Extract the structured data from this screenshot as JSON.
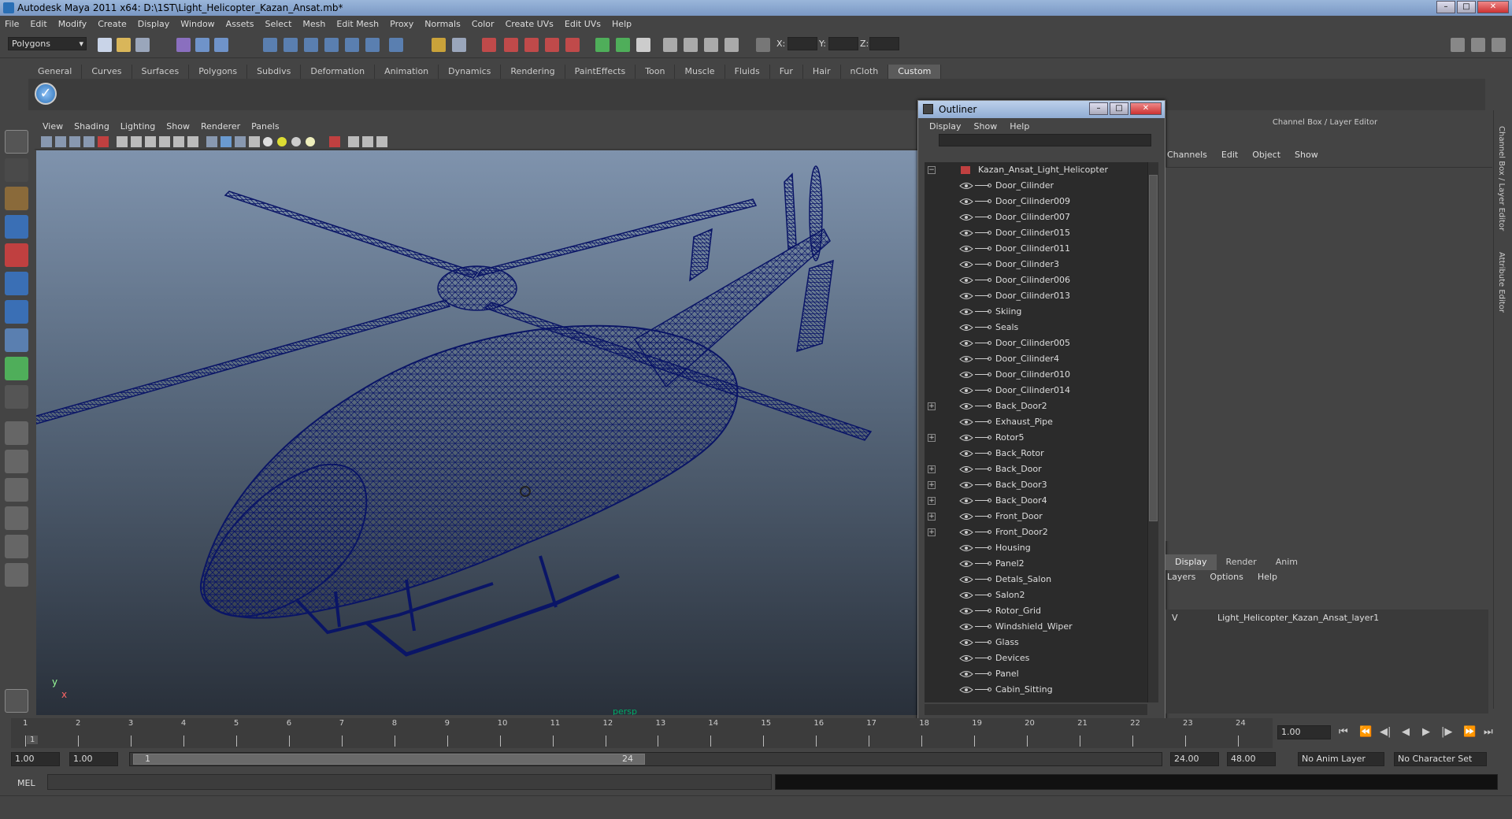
{
  "window": {
    "title": "Autodesk Maya 2011 x64: D:\\1ST\\Light_Helicopter_Kazan_Ansat.mb*",
    "buttons": [
      "–",
      "□",
      "✕"
    ]
  },
  "menubar": [
    "File",
    "Edit",
    "Modify",
    "Create",
    "Display",
    "Window",
    "Assets",
    "Select",
    "Mesh",
    "Edit Mesh",
    "Proxy",
    "Normals",
    "Color",
    "Create UVs",
    "Edit UVs",
    "Help"
  ],
  "toolbar": {
    "mode": "Polygons",
    "coords": {
      "x_label": "X:",
      "y_label": "Y:",
      "z_label": "Z:"
    }
  },
  "shelf": {
    "tabs": [
      "General",
      "Curves",
      "Surfaces",
      "Polygons",
      "Subdivs",
      "Deformation",
      "Animation",
      "Dynamics",
      "Rendering",
      "PaintEffects",
      "Toon",
      "Muscle",
      "Fluids",
      "Fur",
      "Hair",
      "nCloth",
      "Custom"
    ],
    "active": "Custom"
  },
  "viewport": {
    "menu": [
      "View",
      "Shading",
      "Lighting",
      "Show",
      "Renderer",
      "Panels"
    ],
    "camera_label": "persp",
    "axis_y": "y",
    "axis_x": "x",
    "wire_color": "#0a1566"
  },
  "outliner": {
    "title": "Outliner",
    "menu": [
      "Display",
      "Show",
      "Help"
    ],
    "root": "Kazan_Ansat_Light_Helicopter",
    "items": [
      {
        "label": "Door_Cilinder",
        "expandable": false
      },
      {
        "label": "Door_Cilinder009",
        "expandable": false
      },
      {
        "label": "Door_Cilinder007",
        "expandable": false
      },
      {
        "label": "Door_Cilinder015",
        "expandable": false
      },
      {
        "label": "Door_Cilinder011",
        "expandable": false
      },
      {
        "label": "Door_Cilinder3",
        "expandable": false
      },
      {
        "label": "Door_Cilinder006",
        "expandable": false
      },
      {
        "label": "Door_Cilinder013",
        "expandable": false
      },
      {
        "label": "Skiing",
        "expandable": false
      },
      {
        "label": "Seals",
        "expandable": false
      },
      {
        "label": "Door_Cilinder005",
        "expandable": false
      },
      {
        "label": "Door_Cilinder4",
        "expandable": false
      },
      {
        "label": "Door_Cilinder010",
        "expandable": false
      },
      {
        "label": "Door_Cilinder014",
        "expandable": false
      },
      {
        "label": "Back_Door2",
        "expandable": true
      },
      {
        "label": "Exhaust_Pipe",
        "expandable": false
      },
      {
        "label": "Rotor5",
        "expandable": true
      },
      {
        "label": "Back_Rotor",
        "expandable": false
      },
      {
        "label": "Back_Door",
        "expandable": true
      },
      {
        "label": "Back_Door3",
        "expandable": true
      },
      {
        "label": "Back_Door4",
        "expandable": true
      },
      {
        "label": "Front_Door",
        "expandable": true
      },
      {
        "label": "Front_Door2",
        "expandable": true
      },
      {
        "label": "Housing",
        "expandable": false
      },
      {
        "label": "Panel2",
        "expandable": false
      },
      {
        "label": "Detals_Salon",
        "expandable": false
      },
      {
        "label": "Salon2",
        "expandable": false
      },
      {
        "label": "Rotor_Grid",
        "expandable": false
      },
      {
        "label": "Windshield_Wiper",
        "expandable": false
      },
      {
        "label": "Glass",
        "expandable": false
      },
      {
        "label": "Devices",
        "expandable": false
      },
      {
        "label": "Panel",
        "expandable": false
      },
      {
        "label": "Cabin_Sitting",
        "expandable": false
      }
    ]
  },
  "channel_box": {
    "header": "Channel Box / Layer Editor",
    "menu": [
      "Channels",
      "Edit",
      "Object",
      "Show"
    ]
  },
  "layer_editor": {
    "tabs": [
      "Display",
      "Render",
      "Anim"
    ],
    "active_tab": "Display",
    "menu": [
      "Layers",
      "Options",
      "Help"
    ],
    "layer_visible": "V",
    "layer_name": "Light_Helicopter_Kazan_Ansat_layer1"
  },
  "side_tabs": [
    "Channel Box / Layer Editor",
    "Attribute Editor"
  ],
  "time_slider": {
    "ticks": [
      "1",
      "2",
      "3",
      "4",
      "5",
      "6",
      "7",
      "8",
      "9",
      "10",
      "11",
      "12",
      "13",
      "14",
      "15",
      "16",
      "17",
      "18",
      "19",
      "20",
      "21",
      "22",
      "23",
      "24"
    ],
    "current_marker": "1",
    "current_frame": "1.00"
  },
  "range": {
    "start": "1.00",
    "playback_start": "1.00",
    "thumb_start": "1",
    "thumb_end": "24",
    "playback_end": "24.00",
    "end": "48.00",
    "anim_layer": "No Anim Layer",
    "char_set": "No Character Set"
  },
  "command_line": {
    "label": "MEL"
  }
}
